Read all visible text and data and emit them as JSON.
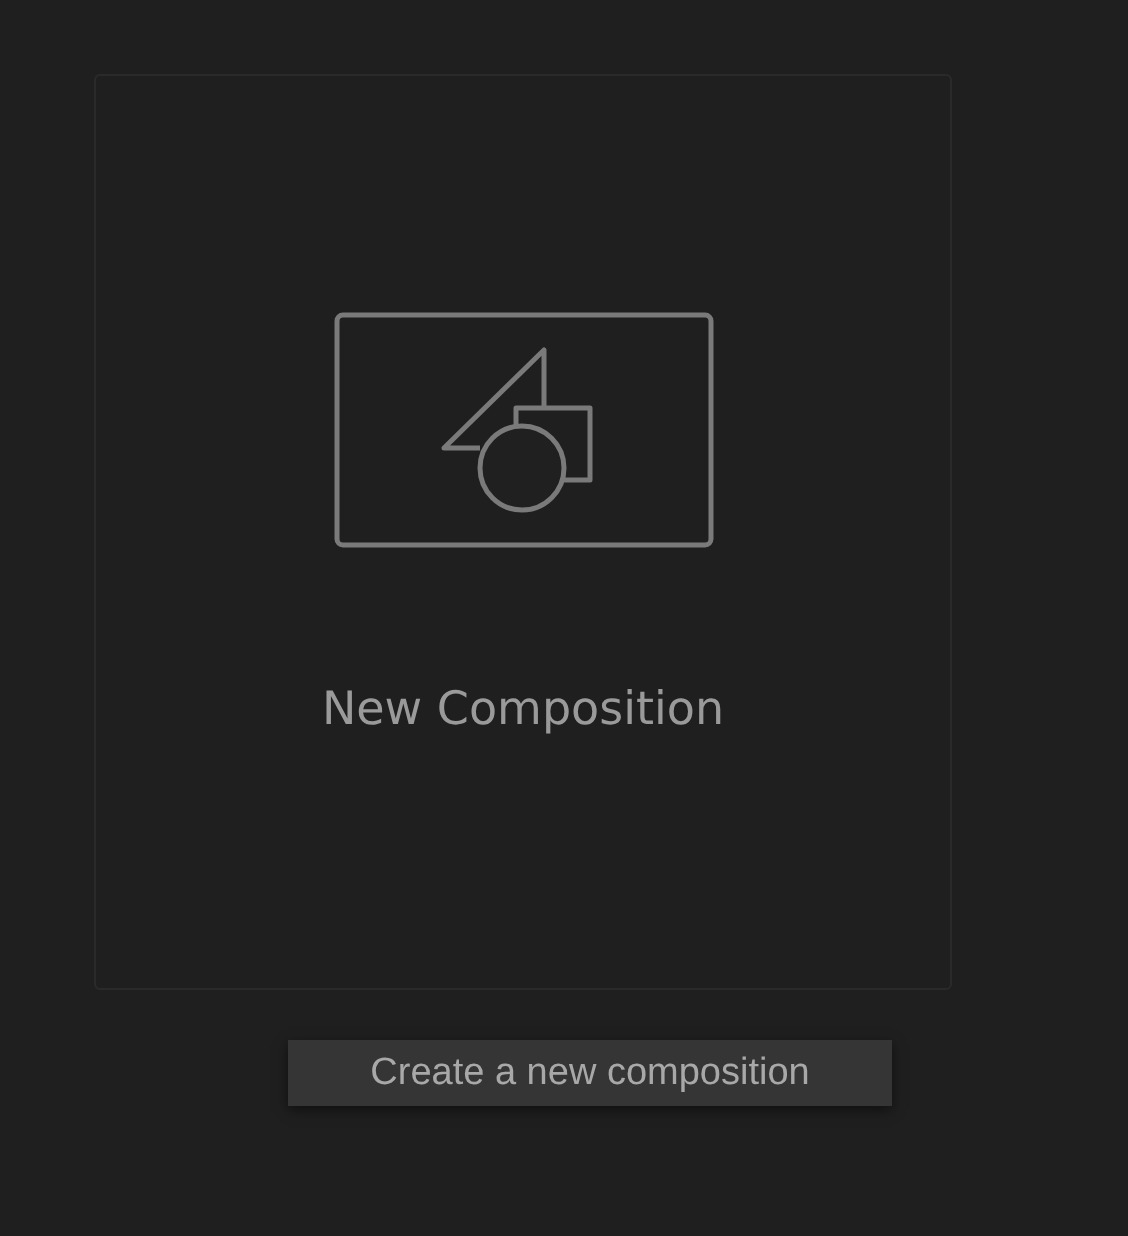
{
  "card": {
    "title": "New Composition"
  },
  "tooltip": {
    "text": "Create a new composition"
  }
}
